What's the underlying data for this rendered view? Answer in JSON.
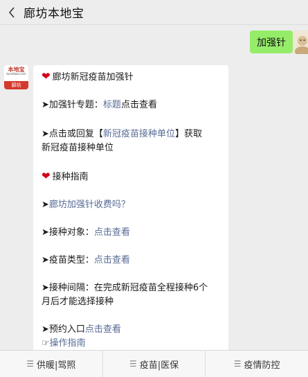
{
  "header": {
    "back_icon": "chevron-left-icon",
    "title": "廊坊本地宝"
  },
  "user_message": {
    "text": "加强针"
  },
  "bot_avatar": {
    "logo_text": "本地宝",
    "logo_url": "bendibao.com",
    "logo_city": "廊坊"
  },
  "bot_message": {
    "line1": {
      "icon": "heart-icon",
      "text": "廊坊新冠疫苗加强针"
    },
    "line2": {
      "arrow": "➤",
      "prefix": "加强针专题：",
      "link1": "标题",
      "link2": "点击查看"
    },
    "line3a": {
      "arrow": "➤",
      "prefix": "点击或回复",
      "bracket_open": "【",
      "link": "新冠疫苗接种单位",
      "bracket_close": "】",
      "suffix": "获取"
    },
    "line3b": {
      "text": "新冠疫苗接种单位"
    },
    "line4": {
      "icon": "heart-icon",
      "text": "接种指南"
    },
    "line5": {
      "arrow": "➤",
      "link": "廊坊加强针收费吗？"
    },
    "line6": {
      "arrow": "➤",
      "prefix": "接种对象：",
      "link": "点击查看"
    },
    "line7": {
      "arrow": "➤",
      "prefix": "疫苗类型：",
      "link": "点击查看"
    },
    "line8a": {
      "arrow": "➤",
      "text": "接种间隔：在完成新冠疫苗全程接种6个"
    },
    "line8b": {
      "text": "月后才能选择接种"
    },
    "line9": {
      "arrow": "➤",
      "prefix": "预约入口",
      "link": "点击查看"
    },
    "line10": {
      "icon": "pointing-hand-icon",
      "link": "操作指南"
    }
  },
  "bottom_menu": {
    "items": [
      {
        "icon": "menu-icon",
        "label": "供暖|驾照"
      },
      {
        "icon": "menu-icon",
        "label": "疫苗|医保"
      },
      {
        "icon": "menu-icon",
        "label": "疫情防控"
      }
    ]
  },
  "colors": {
    "background": "#ededed",
    "user_bubble": "#95ec69",
    "link": "#576b95",
    "heart": "#d0021b"
  }
}
